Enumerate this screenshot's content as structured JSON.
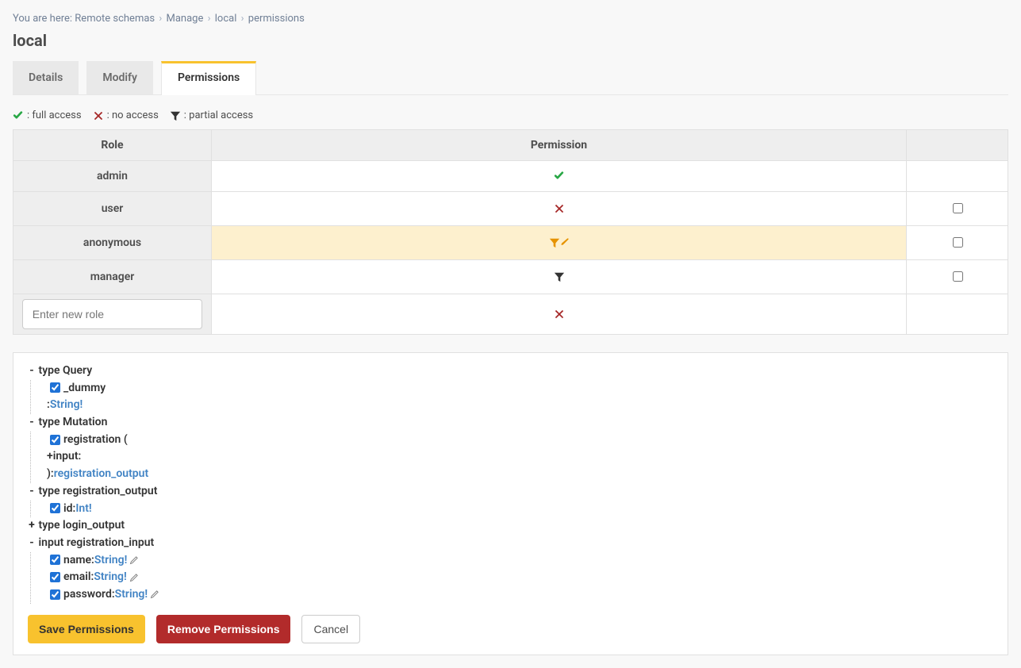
{
  "breadcrumb": {
    "prefix": "You are here:",
    "items": [
      "Remote schemas",
      "Manage",
      "local",
      "permissions"
    ]
  },
  "page_title": "local",
  "tabs": [
    {
      "label": "Details",
      "active": false
    },
    {
      "label": "Modify",
      "active": false
    },
    {
      "label": "Permissions",
      "active": true
    }
  ],
  "legend": {
    "full": ": full access",
    "no": ": no access",
    "partial": ": partial access"
  },
  "perm_table": {
    "headers": {
      "role": "Role",
      "permission": "Permission"
    },
    "rows": [
      {
        "role": "admin",
        "icon": "check",
        "checkbox": null,
        "highlight": false
      },
      {
        "role": "user",
        "icon": "cross",
        "checkbox": false,
        "highlight": false
      },
      {
        "role": "anonymous",
        "icon": "filter-pencil",
        "checkbox": false,
        "highlight": true
      },
      {
        "role": "manager",
        "icon": "filter-dark",
        "checkbox": false,
        "highlight": false
      }
    ],
    "new_role_placeholder": "Enter new role",
    "new_role_icon": "cross"
  },
  "schema_tree": [
    {
      "toggle": "-",
      "label": "type Query",
      "children": [
        {
          "checkbox": true,
          "label": "_dummy"
        },
        {
          "indent_colon": true,
          "tlink": "String!"
        }
      ]
    },
    {
      "toggle": "-",
      "label": "type Mutation",
      "children": [
        {
          "checkbox": true,
          "label": "registration",
          "suffix": " ("
        },
        {
          "prefix": "+input:"
        },
        {
          "prefix": "):",
          "tlink": "registration_output"
        }
      ]
    },
    {
      "toggle": "-",
      "label": "type registration_output",
      "children": [
        {
          "checkbox": true,
          "label": "id:",
          "tlink": "Int!"
        }
      ]
    },
    {
      "toggle": "+",
      "label": "type login_output"
    },
    {
      "toggle": "-",
      "label": "input registration_input",
      "children": [
        {
          "checkbox": true,
          "label": "name:",
          "tlink": "String!",
          "pencil": true
        },
        {
          "checkbox": true,
          "label": "email:",
          "tlink": "String!",
          "pencil": true
        },
        {
          "checkbox": true,
          "label": "password:",
          "tlink": "String!",
          "pencil": true
        }
      ]
    }
  ],
  "buttons": {
    "save": "Save Permissions",
    "remove": "Remove Permissions",
    "cancel": "Cancel"
  }
}
